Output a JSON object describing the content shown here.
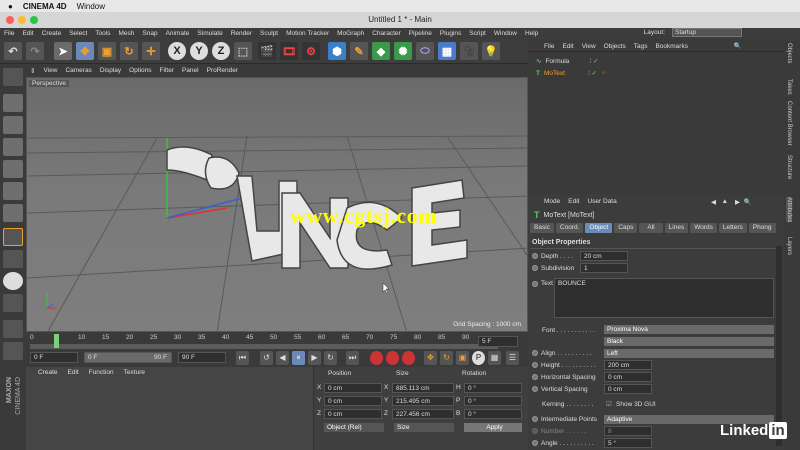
{
  "macbar": {
    "app": "CINEMA 4D",
    "menu": "Window"
  },
  "window_title": "Untitled 1 * - Main",
  "menubar": [
    "File",
    "Edit",
    "Create",
    "Select",
    "Tools",
    "Mesh",
    "Snap",
    "Animate",
    "Simulate",
    "Render",
    "Sculpt",
    "Motion Tracker",
    "MoGraph",
    "Character",
    "Pipeline",
    "Plugins",
    "Script",
    "Window",
    "Help"
  ],
  "layout": {
    "label": "Layout:",
    "value": "Startup"
  },
  "toolbar": {
    "x": "X",
    "y": "Y",
    "z": "Z"
  },
  "viewport_menu": [
    "View",
    "Cameras",
    "Display",
    "Options",
    "Filter",
    "Panel",
    "ProRender"
  ],
  "viewport": {
    "label": "Perspective",
    "grid_spacing": "Grid Spacing : 1000 cm",
    "text_3d": "BOUNCE"
  },
  "timeline": {
    "ticks": [
      "0",
      "5",
      "10",
      "15",
      "20",
      "25",
      "30",
      "35",
      "40",
      "45",
      "50",
      "55",
      "60",
      "65",
      "70",
      "75",
      "80",
      "85",
      "90"
    ],
    "current_frame": "5 F",
    "start": "0 F",
    "min": "0 F",
    "max": "90 F",
    "end": "90 F"
  },
  "material_menu": [
    "Create",
    "Edit",
    "Function",
    "Texture"
  ],
  "coords": {
    "headers": [
      "Position",
      "Size",
      "Rotation"
    ],
    "rows": [
      {
        "axis": "X",
        "pos": "0 cm",
        "sizel": "X",
        "size": "885.113 cm",
        "rotl": "H",
        "rot": "0 °"
      },
      {
        "axis": "Y",
        "pos": "0 cm",
        "sizel": "Y",
        "size": "215.495 cm",
        "rotl": "P",
        "rot": "0 °"
      },
      {
        "axis": "Z",
        "pos": "0 cm",
        "sizel": "Z",
        "size": "227.456 cm",
        "rotl": "B",
        "rot": "0 °"
      }
    ],
    "mode": "Object (Rel)",
    "size_mode": "Size",
    "apply": "Apply"
  },
  "object_manager": {
    "menu": [
      "File",
      "Edit",
      "View",
      "Objects",
      "Tags",
      "Bookmarks"
    ],
    "objects": [
      {
        "name": "Formula"
      },
      {
        "name": "MoText"
      }
    ]
  },
  "attributes": {
    "menu": [
      "Mode",
      "Edit",
      "User Data"
    ],
    "object_title": "MoText [MoText]",
    "tabs": [
      "Basic",
      "Coord.",
      "Object",
      "Caps",
      "All",
      "Lines",
      "Words",
      "Letters",
      "Phong"
    ],
    "active_tab": "Object",
    "section": "Object Properties",
    "depth_label": "Depth . . . .",
    "depth": "20 cm",
    "subdiv_label": "Subdivision",
    "subdiv": "1",
    "text_label": "Text",
    "text": "BOUNCE",
    "font_label": "Font . . . . . . . . . . .",
    "font": "Proxima Nova",
    "weight": "Black",
    "align_label": "Align . . . . . . . . . .",
    "align": "Left",
    "height_label": "Height . . . . . . . . . .",
    "height": "200 cm",
    "hspacing_label": "Horizontal Spacing",
    "hspacing": "0 cm",
    "vspacing_label": "Vertical Spacing",
    "vspacing": "0 cm",
    "kerning_label": "Kerning . . . . . . . .",
    "show3d": "Show 3D GUI",
    "interp_label": "Intermediate Points",
    "interp": "Adaptive",
    "number_label": "Number . . . . . .",
    "number": "8",
    "angle_label": "Angle . . . . . . . . . .",
    "angle": "5 °"
  },
  "side_tabs": [
    "Objects",
    "Takes",
    "Content Browser",
    "Structure",
    "Attributes",
    "Layers"
  ],
  "watermark": "www.cgtsj.com",
  "branding": {
    "maxon": "MAXON",
    "c4d": "CINEMA 4D",
    "linkedin": "Linked",
    "linkedin_box": "in"
  }
}
